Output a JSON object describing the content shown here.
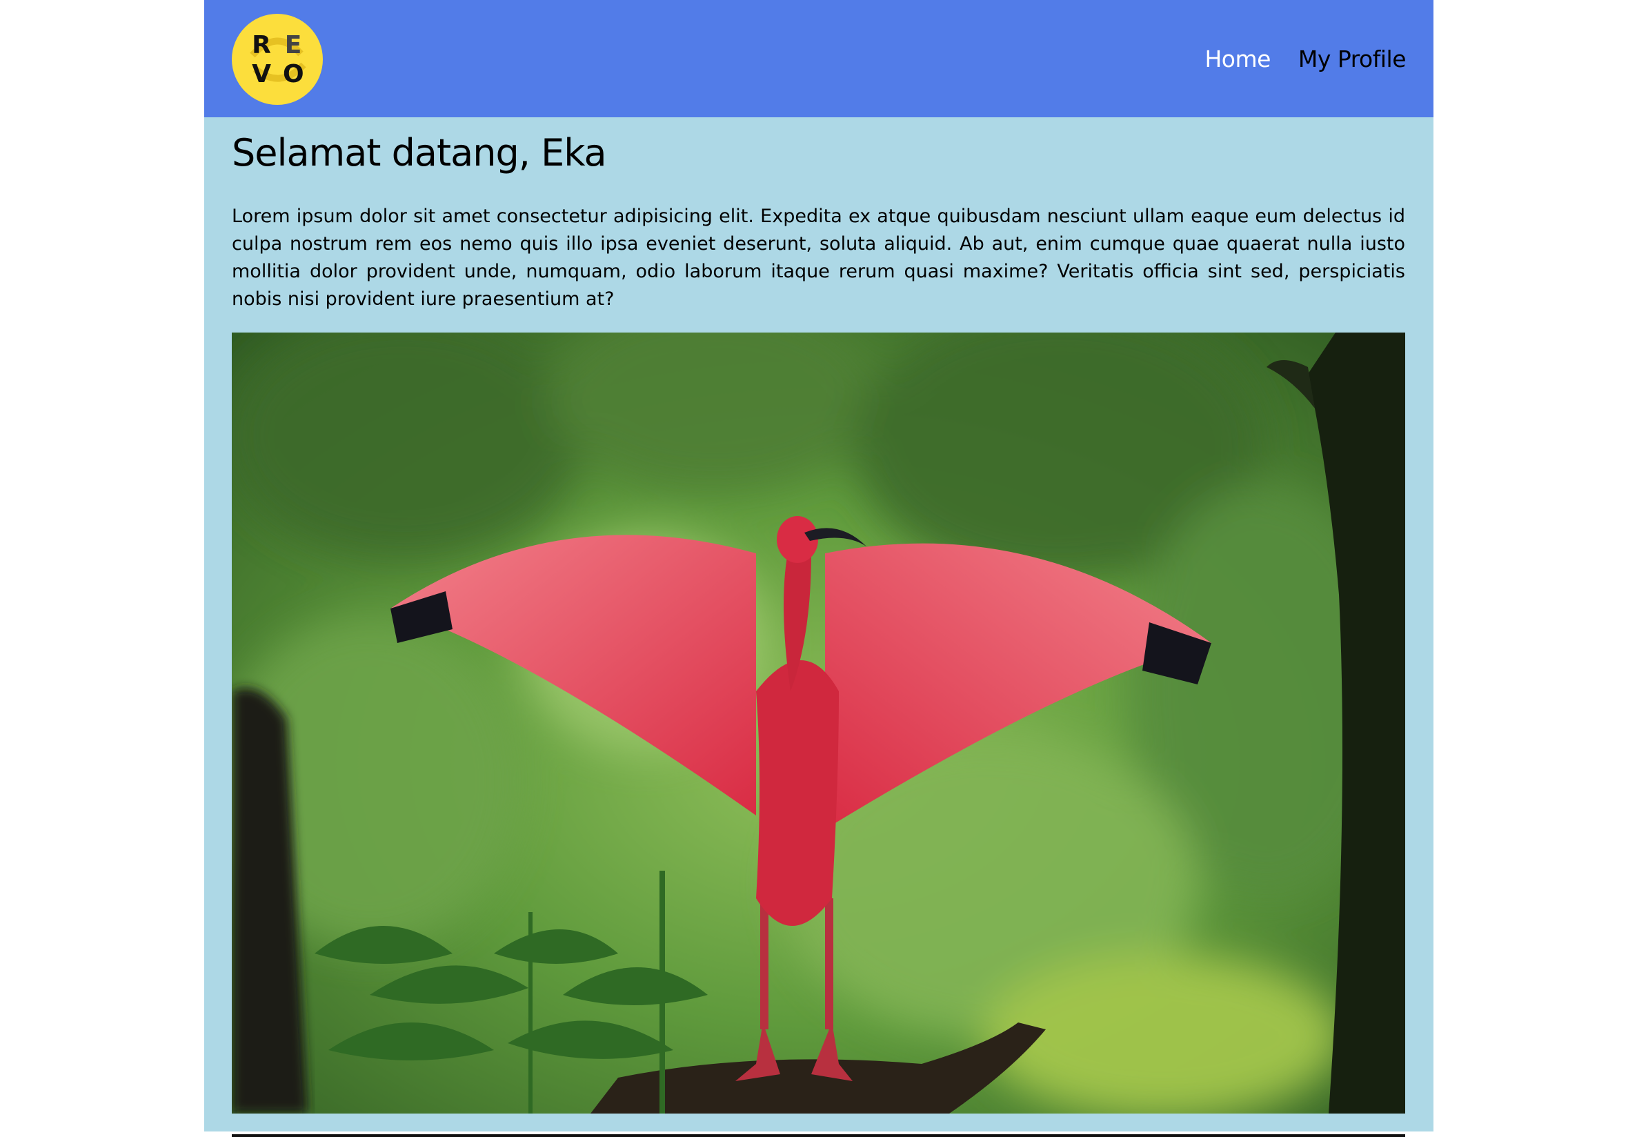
{
  "navbar": {
    "logo_letters": [
      "R",
      "E",
      "V",
      "O"
    ],
    "links": [
      "Home",
      "My Profile"
    ],
    "color": "#527ce8"
  },
  "main": {
    "title": "Selamat datang, Eka",
    "description": "Lorem ipsum dolor sit amet consectetur adipisicing elit. Expedita ex atque quibusdam nesciunt ullam eaque eum delectus id culpa nostrum rem eos nemo quis illo ipsa eveniet deserunt, soluta aliquid. Ab aut, enim cumque quae quaerat nulla iusto mollitia dolor provident unde, numquam, odio laborum itaque rerum quasi maxime? Veritatis officia sint sed, perspiciatis nobis nisi provident iure praesentium at?",
    "background": "#add8e6"
  },
  "hero_image": {
    "subject": "scarlet ibis with spread wings in a green forest"
  }
}
